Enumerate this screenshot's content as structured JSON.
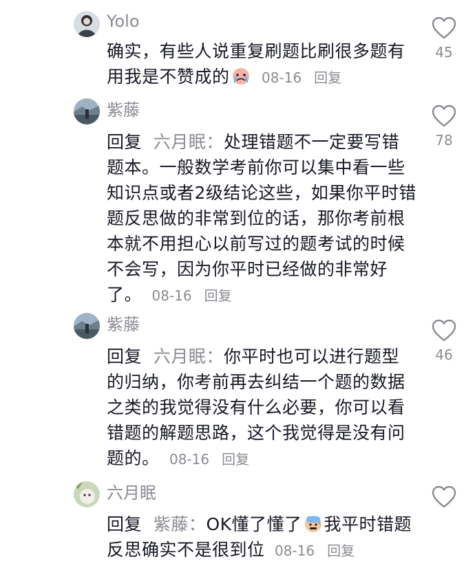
{
  "comments": [
    {
      "username": "Yolo",
      "text_before_emoji": "确实，有些人说重复刷题比刷很多题有用我是不赞成的",
      "emoji": "crying-face-emoji",
      "date": "08-16",
      "reply_label": "回复",
      "likes": "45"
    },
    {
      "username": "紫藤",
      "reply_prefix": "回复",
      "reply_target": "六月眠：",
      "text": "处理错题不一定要写错题本。一般数学考前你可以集中看一些知识点或者2级结论这些，如果你平时错题反思做的非常到位的话，那你考前根本就不用担心以前写过的题考试的时候不会写，因为你平时已经做的非常好了。",
      "date": "08-16",
      "reply_label": "回复",
      "likes": "78"
    },
    {
      "username": "紫藤",
      "reply_prefix": "回复",
      "reply_target": "六月眠：",
      "text": "你平时也可以进行题型的归纳，你考前再去纠结一个题的数据之类的我觉得没有什么必要，你可以看错题的解题思路，这个我觉得是没有问题的。",
      "date": "08-16",
      "reply_label": "回复",
      "likes": "46"
    },
    {
      "username": "六月眠",
      "reply_prefix": "回复",
      "reply_target": "紫藤：",
      "text_before_emoji": "OK懂了懂了",
      "emoji": "cold-sweat-face-emoji",
      "text_after_emoji": "我平时错题反思确实不是很到位",
      "date": "08-16",
      "reply_label": "回复",
      "likes": ""
    }
  ],
  "colors": {
    "text": "#161823",
    "secondary": "#8a8b91",
    "background": "#ffffff"
  }
}
